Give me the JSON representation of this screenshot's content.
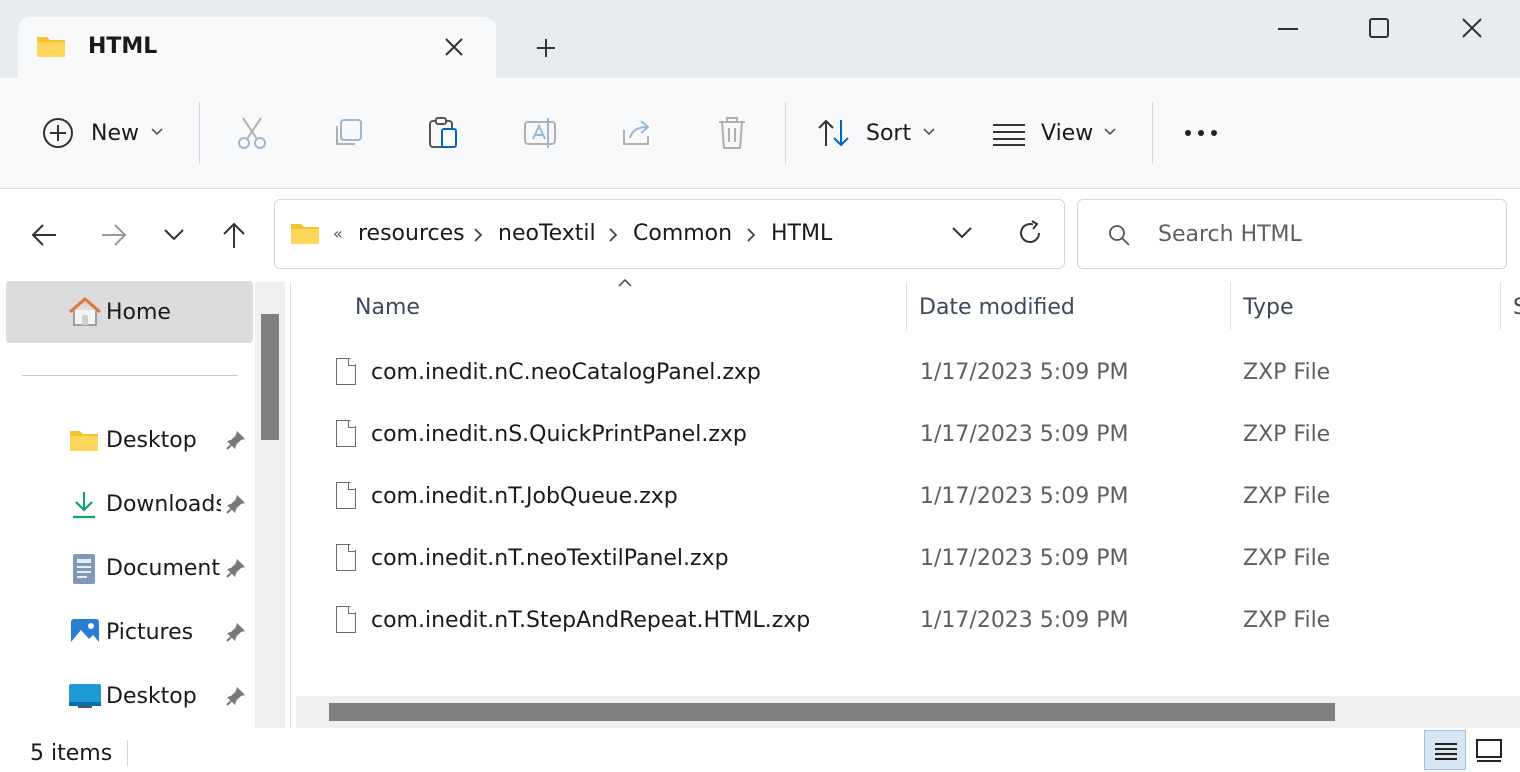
{
  "window": {
    "tab_title": "HTML",
    "controls": {
      "minimize": "minimize-icon",
      "maximize": "maximize-icon",
      "close": "close-icon"
    }
  },
  "toolbar": {
    "new_label": "New",
    "sort_label": "Sort",
    "view_label": "View",
    "icons": [
      "cut-icon",
      "copy-icon",
      "paste-icon",
      "rename-icon",
      "share-icon",
      "delete-icon",
      "more-icon"
    ]
  },
  "navigation": {
    "breadcrumb_overflow": "«",
    "breadcrumbs": [
      "resources",
      "neoTextil",
      "Common",
      "HTML"
    ],
    "search_placeholder": "Search HTML"
  },
  "sidebar": {
    "home_label": "Home",
    "items": [
      {
        "label": "Desktop",
        "icon": "folder-icon"
      },
      {
        "label": "Downloads",
        "icon": "download-icon"
      },
      {
        "label": "Documents",
        "icon": "documents-icon"
      },
      {
        "label": "Pictures",
        "icon": "pictures-icon"
      },
      {
        "label": "Desktop",
        "icon": "desktop-icon"
      }
    ]
  },
  "file_list": {
    "columns": [
      "Name",
      "Date modified",
      "Type",
      "S"
    ],
    "rows": [
      {
        "name": "com.inedit.nC.neoCatalogPanel.zxp",
        "date": "1/17/2023 5:09 PM",
        "type": "ZXP File"
      },
      {
        "name": "com.inedit.nS.QuickPrintPanel.zxp",
        "date": "1/17/2023 5:09 PM",
        "type": "ZXP File"
      },
      {
        "name": "com.inedit.nT.JobQueue.zxp",
        "date": "1/17/2023 5:09 PM",
        "type": "ZXP File"
      },
      {
        "name": "com.inedit.nT.neoTextilPanel.zxp",
        "date": "1/17/2023 5:09 PM",
        "type": "ZXP File"
      },
      {
        "name": "com.inedit.nT.StepAndRepeat.HTML.zxp",
        "date": "1/17/2023 5:09 PM",
        "type": "ZXP File"
      }
    ]
  },
  "status": {
    "item_count": "5 items"
  },
  "colors": {
    "titlebar": "#e8ecef",
    "toolbar": "#f8f9fb",
    "selected_nav": "#dcdcdc",
    "accent": "#0067c0"
  }
}
